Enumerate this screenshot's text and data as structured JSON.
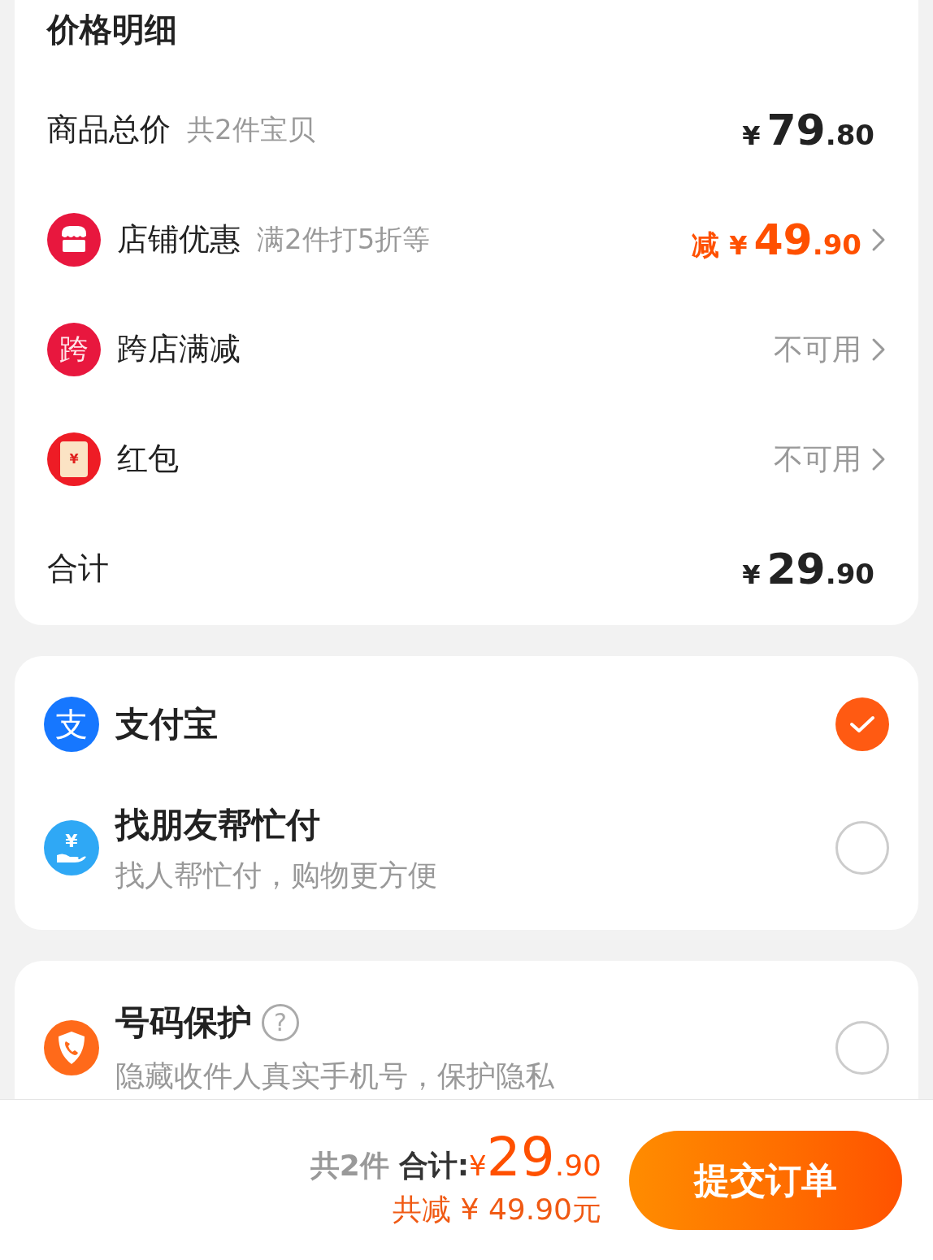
{
  "price_detail": {
    "title": "价格明细",
    "rows": [
      {
        "kind": "amount",
        "label": "商品总价",
        "note": "共2件宝贝",
        "price": {
          "symbol": "¥",
          "whole": "79",
          "fraction": ".80"
        }
      },
      {
        "kind": "discount",
        "label": "店铺优惠",
        "note": "满2件打5折等",
        "price": {
          "prefix": "减",
          "symbol": "¥",
          "whole": "49",
          "fraction": ".90"
        }
      },
      {
        "kind": "status",
        "icon_text": "跨",
        "label": "跨店满减",
        "status": "不可用"
      },
      {
        "kind": "status",
        "icon_text": "¥",
        "label": "红包",
        "status": "不可用"
      },
      {
        "kind": "amount",
        "label": "合计",
        "price": {
          "symbol": "¥",
          "whole": "29",
          "fraction": ".90"
        }
      }
    ]
  },
  "payment_methods": [
    {
      "icon_text": "支",
      "label": "支付宝",
      "selected": true
    },
    {
      "icon_text": "¥",
      "label": "找朋友帮忙付",
      "description": "找人帮忙付，购物更方便",
      "selected": false
    }
  ],
  "number_protection": {
    "label": "号码保护",
    "help": "?",
    "description": "隐藏收件人真实手机号，保护隐私",
    "checked": false
  },
  "bottom_bar": {
    "count": "共2件",
    "total_label": "合计:",
    "symbol": "¥",
    "whole": "29",
    "fraction": ".90",
    "savings": "共减 ¥ 49.90元",
    "submit": "提交订单"
  }
}
